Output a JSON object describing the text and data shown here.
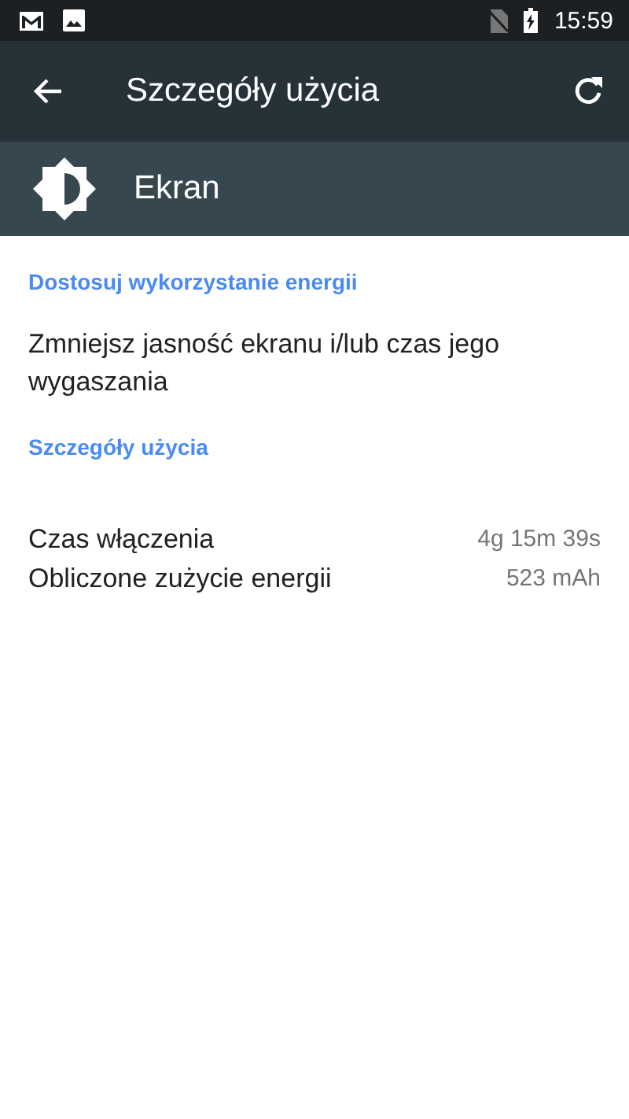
{
  "status_bar": {
    "time": "15:59"
  },
  "toolbar": {
    "title": "Szczegóły użycia"
  },
  "app_header": {
    "name": "Ekran"
  },
  "sections": [
    {
      "title": "Dostosuj wykorzystanie energii",
      "items": [
        {
          "kind": "text",
          "text": "Zmniejsz jasność ekranu i/lub czas jego wygaszania"
        }
      ]
    },
    {
      "title": "Szczegóły użycia",
      "items": [
        {
          "kind": "pair",
          "label": "Czas włączenia",
          "value": "4g 15m 39s"
        },
        {
          "kind": "pair",
          "label": "Obliczone zużycie energii",
          "value": "523 mAh"
        }
      ]
    }
  ]
}
